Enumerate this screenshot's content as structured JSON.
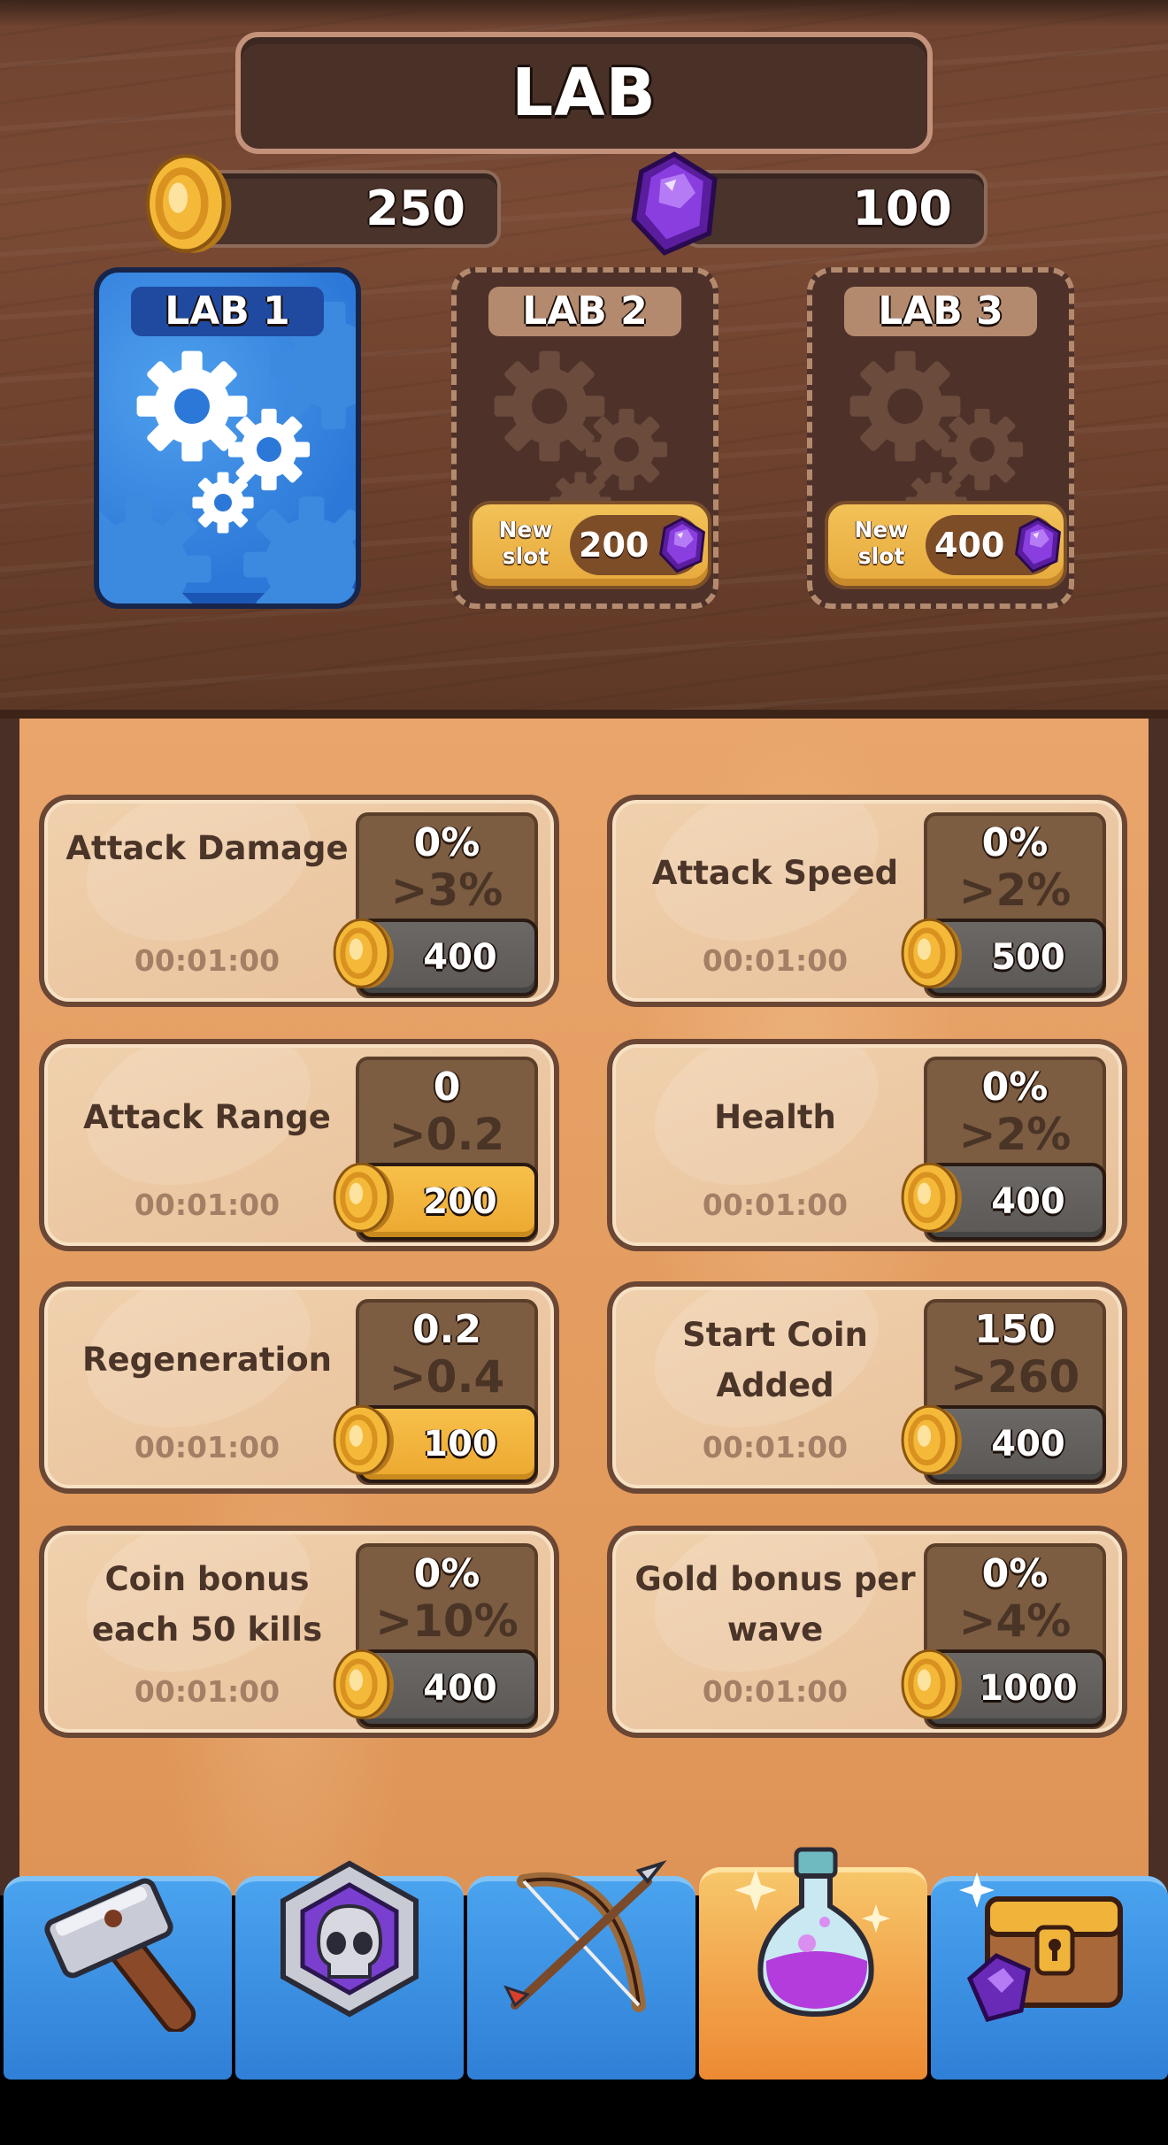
{
  "header": {
    "title": "LAB"
  },
  "currencies": {
    "coins": {
      "amount": "250",
      "icon": "coin-icon"
    },
    "gems": {
      "amount": "100",
      "icon": "gem-icon"
    }
  },
  "lab_slots": [
    {
      "label": "LAB 1",
      "state": "active"
    },
    {
      "label": "LAB 2",
      "state": "locked",
      "new_slot_label": "New slot",
      "price": "200"
    },
    {
      "label": "LAB 3",
      "state": "locked",
      "new_slot_label": "New slot",
      "price": "400"
    }
  ],
  "upgrades": [
    {
      "name": "Attack Damage",
      "timer": "00:01:00",
      "current": "0%",
      "next": ">3%",
      "cost": "400",
      "affordable": false
    },
    {
      "name": "Attack Speed",
      "timer": "00:01:00",
      "current": "0%",
      "next": ">2%",
      "cost": "500",
      "affordable": false
    },
    {
      "name": "Attack Range",
      "timer": "00:01:00",
      "current": "0",
      "next": ">0.2",
      "cost": "200",
      "affordable": true
    },
    {
      "name": "Health",
      "timer": "00:01:00",
      "current": "0%",
      "next": ">2%",
      "cost": "400",
      "affordable": false
    },
    {
      "name": "Regeneration",
      "timer": "00:01:00",
      "current": "0.2",
      "next": ">0.4",
      "cost": "100",
      "affordable": true
    },
    {
      "name": "Start Coin Added",
      "timer": "00:01:00",
      "current": "150",
      "next": ">260",
      "cost": "400",
      "affordable": false
    },
    {
      "name": "Coin bonus each 50 kills",
      "timer": "00:01:00",
      "current": "0%",
      "next": ">10%",
      "cost": "400",
      "affordable": false
    },
    {
      "name": "Gold bonus per wave",
      "timer": "00:01:00",
      "current": "0%",
      "next": ">4%",
      "cost": "1000",
      "affordable": false
    }
  ],
  "nav": {
    "tabs": [
      {
        "icon": "hammer-icon",
        "active": false
      },
      {
        "icon": "skull-badge-icon",
        "active": false
      },
      {
        "icon": "bow-arrow-icon",
        "active": false
      },
      {
        "icon": "potion-flask-icon",
        "active": true
      },
      {
        "icon": "treasure-chest-icon",
        "active": false
      }
    ]
  },
  "colors": {
    "wood": "#6e4330",
    "panel": "#e9a56b",
    "lab_active": "#2c78d8",
    "cost_gold": "#eca830",
    "cost_gray": "#5b5855",
    "nav_blue": "#2f7fd6",
    "nav_active": "#f2a34a"
  }
}
